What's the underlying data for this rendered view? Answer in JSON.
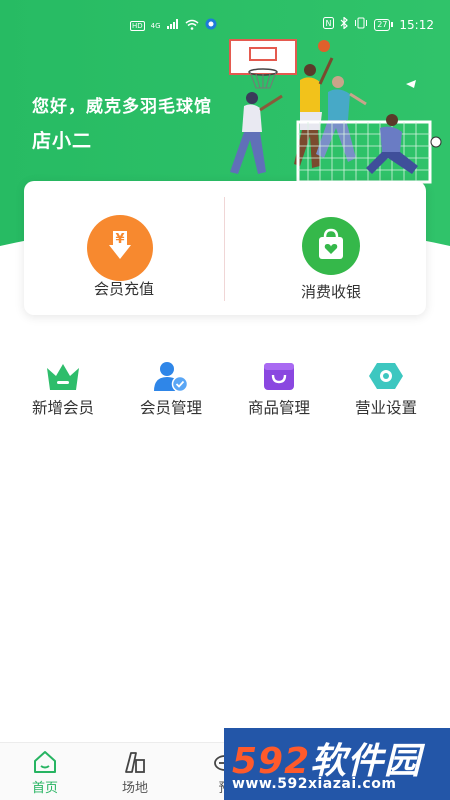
{
  "status_bar": {
    "left": [
      "HD",
      "4G",
      "signal-icon",
      "wifi-icon",
      "status-app-icon"
    ],
    "right_icons": [
      "nfc-icon",
      "bluetooth-icon",
      "vibrate-icon"
    ],
    "battery": "27",
    "time": "15:12"
  },
  "header": {
    "greeting": "您好，威克多羽毛球馆",
    "owner": "店小二"
  },
  "main_card": {
    "recharge_label": "会员充值",
    "recharge_icon": "yen-download-icon",
    "checkout_label": "消费收银",
    "checkout_icon": "shopping-bag-heart-icon"
  },
  "shortcuts": [
    {
      "label": "新增会员",
      "icon": "crown-icon",
      "color": "#2ebd6b"
    },
    {
      "label": "会员管理",
      "icon": "member-check-icon",
      "color": "#2f86e8"
    },
    {
      "label": "商品管理",
      "icon": "shopping-box-icon",
      "color": "#8a47e0"
    },
    {
      "label": "营业设置",
      "icon": "hexagon-setting-icon",
      "color": "#3dc7c0"
    }
  ],
  "tabbar": [
    {
      "label": "首页",
      "icon": "home-icon",
      "active": true
    },
    {
      "label": "场地",
      "icon": "venue-icon",
      "active": false
    },
    {
      "label": "预",
      "icon": "booking-icon",
      "active": false
    }
  ],
  "watermark": {
    "brand_num": "592",
    "brand_text": "软件园",
    "url": "www.592xiazai.com"
  },
  "colors": {
    "brand_green": "#27b462",
    "orange": "#f7892f",
    "green_icon": "#35b84a"
  }
}
